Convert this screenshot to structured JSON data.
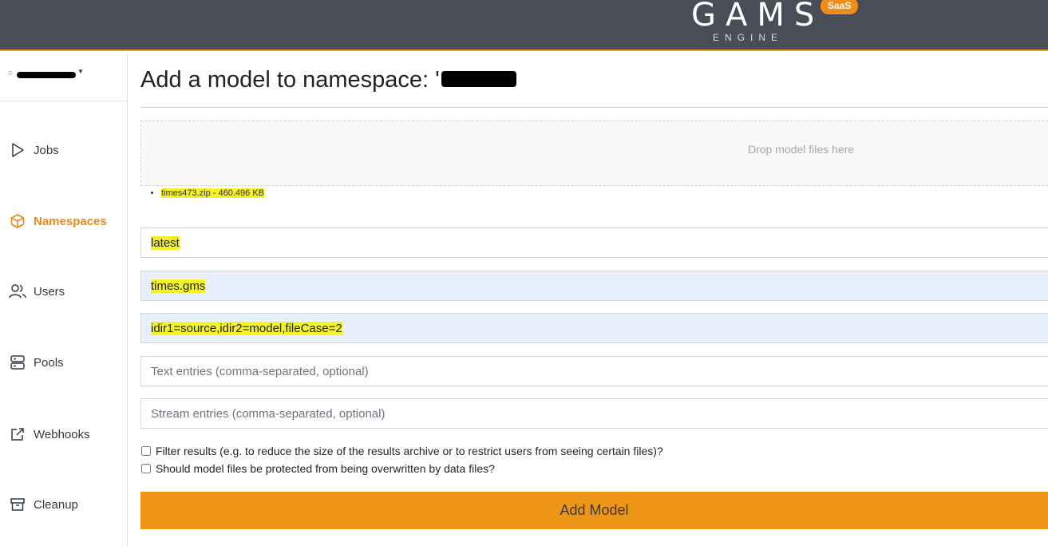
{
  "header": {
    "brand_name": "GAMS",
    "brand_sub": "ENGINE",
    "brand_badge": "SaaS"
  },
  "sidebar": {
    "items": [
      {
        "label": "Jobs",
        "icon": "play-outline-icon"
      },
      {
        "label": "Namespaces",
        "icon": "cube-icon",
        "active": true
      },
      {
        "label": "Users",
        "icon": "users-icon"
      },
      {
        "label": "Pools",
        "icon": "server-icon"
      },
      {
        "label": "Webhooks",
        "icon": "external-link-icon"
      },
      {
        "label": "Cleanup",
        "icon": "archive-box-icon"
      }
    ]
  },
  "main": {
    "title": "Add a model to namespace: '",
    "dropzone_text": "Drop model files here",
    "files": [
      "times473.zip - 460.496 KB"
    ],
    "fields": {
      "version_value": "latest",
      "run_value": "times.gms",
      "args_value": "idir1=source,idir2=model,fileCase=2",
      "text_entries_placeholder": "Text entries (comma-separated, optional)",
      "stream_entries_placeholder": "Stream entries (comma-separated, optional)"
    },
    "checkboxes": {
      "filter_label": "Filter results (e.g. to reduce the size of the results archive or to restrict users from seeing certain files)?",
      "protect_label": "Should model files be protected from being overwritten by data files?"
    },
    "submit_label": "Add Model"
  },
  "colors": {
    "accent": "#ee9416",
    "header_bg": "#484d57",
    "highlight": "#f5f227",
    "autofill_bg": "#e8f0fe"
  }
}
